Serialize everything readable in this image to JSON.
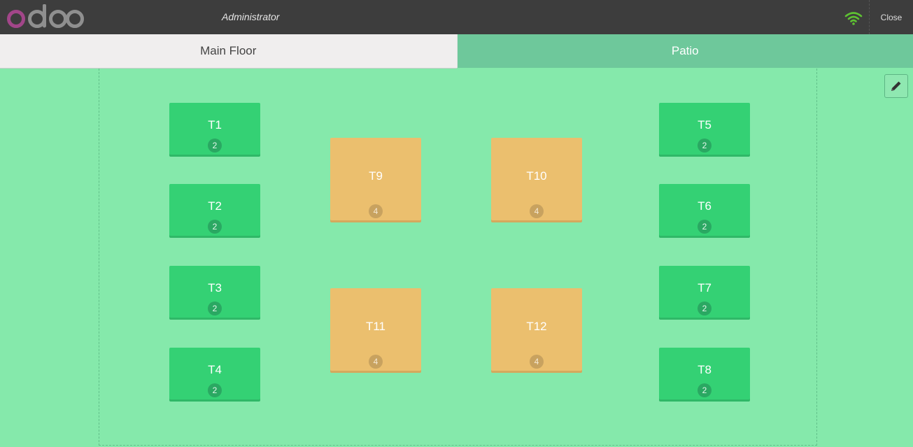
{
  "header": {
    "user": "Administrator",
    "close_label": "Close",
    "logo_text": "odoo",
    "colors": {
      "bar": "#3d3d3d",
      "wifi": "#5ec232"
    }
  },
  "tabs": [
    {
      "label": "Main Floor",
      "active": false
    },
    {
      "label": "Patio",
      "active": true
    }
  ],
  "floor": {
    "edit_icon": "pencil-icon",
    "colors": {
      "background": "#85e9ab",
      "available": "#34d174",
      "occupied": "#ebbf6e"
    }
  },
  "tables": [
    {
      "name": "T1",
      "seats": "2"
    },
    {
      "name": "T2",
      "seats": "2"
    },
    {
      "name": "T3",
      "seats": "2"
    },
    {
      "name": "T4",
      "seats": "2"
    },
    {
      "name": "T5",
      "seats": "2"
    },
    {
      "name": "T6",
      "seats": "2"
    },
    {
      "name": "T7",
      "seats": "2"
    },
    {
      "name": "T8",
      "seats": "2"
    },
    {
      "name": "T9",
      "seats": "4"
    },
    {
      "name": "T10",
      "seats": "4"
    },
    {
      "name": "T11",
      "seats": "4"
    },
    {
      "name": "T12",
      "seats": "4"
    }
  ]
}
